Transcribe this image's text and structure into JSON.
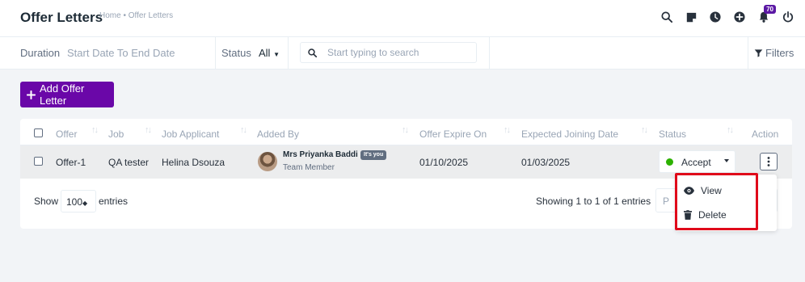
{
  "header": {
    "title": "Offer Letters",
    "breadcrumb": "Home • Offer Letters",
    "notification_count": "70",
    "icons": [
      "search-icon",
      "sticky-note-icon",
      "clock-icon",
      "plus-circle-icon",
      "bell-icon",
      "power-icon"
    ]
  },
  "filters": {
    "duration_label": "Duration",
    "date_range": "Start Date To End Date",
    "status_label": "Status",
    "status_value": "All",
    "search_placeholder": "Start typing to search",
    "filters_label": "Filters"
  },
  "actions": {
    "add_label": "Add Offer Letter"
  },
  "table": {
    "columns": [
      "Offer",
      "Job",
      "Job Applicant",
      "Added By",
      "Offer Expire On",
      "Expected Joining Date",
      "Status",
      "Action"
    ],
    "rows": [
      {
        "offer": "Offer-1",
        "job": "QA tester",
        "applicant": "Helina Dsouza",
        "added_by_name": "Mrs Priyanka Baddi",
        "added_by_badge": "It's you",
        "added_by_role": "Team Member",
        "expire_on": "01/10/2025",
        "joining_date": "01/03/2025",
        "status": "Accept"
      }
    ],
    "show_label": "Show",
    "entries_value": "100",
    "entries_label": "entries",
    "showing_text": "Showing 1 to 1 of 1 entries",
    "prev_label": "P"
  },
  "action_menu": {
    "items": [
      {
        "label": "View",
        "icon": "eye-icon"
      },
      {
        "label": "Delete",
        "icon": "trash-icon"
      }
    ]
  },
  "colors": {
    "primary": "#6a07a8",
    "accept_dot": "#2cb100",
    "highlight": "#e0091a",
    "badge": "#5b18a4"
  }
}
